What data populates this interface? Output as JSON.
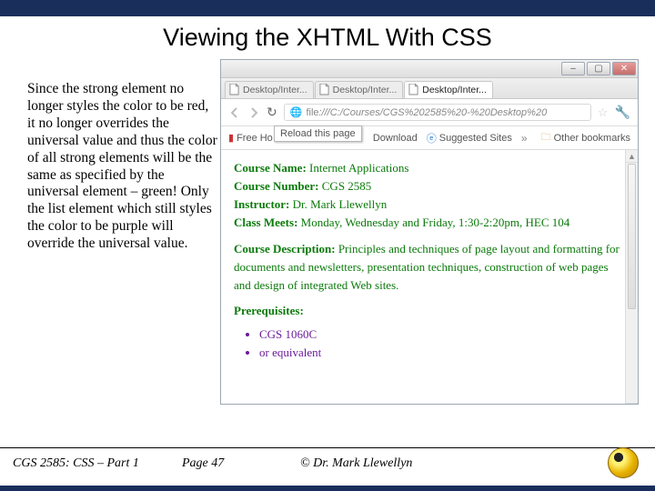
{
  "title": "Viewing the XHTML With CSS",
  "explanation": "Since the strong element no longer styles the color to be red, it no longer overrides the universal value and thus the color of all strong elements will be the same as specified by the universal element – green!   Only the list element which still styles the color to be purple will override the universal value.",
  "browser": {
    "tabs": [
      {
        "label": "Desktop/Inter...",
        "active": false
      },
      {
        "label": "Desktop/Inter...",
        "active": false
      },
      {
        "label": "Desktop/Inter...",
        "active": true
      }
    ],
    "url_prefix": "file",
    "url_rest": ":///C:/Courses/CGS%202585%20-%20Desktop%20",
    "tooltip": "Reload this page",
    "bookmarks": {
      "free": "Free Ho",
      "download": "Download",
      "suggested": "Suggested Sites",
      "other": "Other bookmarks"
    },
    "chevron": "»",
    "page": {
      "course_name_label": "Course Name:",
      "course_name": "Internet Applications",
      "course_number_label": "Course Number:",
      "course_number": "CGS 2585",
      "instructor_label": "Instructor:",
      "instructor": "Dr. Mark Llewellyn",
      "class_meets_label": "Class Meets:",
      "class_meets": "Monday, Wednesday and Friday, 1:30-2:20pm, HEC 104",
      "desc_label": "Course Description:",
      "desc": "Principles and techniques of page layout and formatting for documents and newsletters, presentation techniques, construction of web pages and design of integrated Web sites.",
      "prereq_label": "Prerequisites:",
      "prereq_items": [
        "CGS 1060C",
        "or equivalent"
      ]
    }
  },
  "footer": {
    "left": "CGS 2585: CSS – Part 1",
    "mid": "Page 47",
    "right": "© Dr. Mark Llewellyn"
  }
}
